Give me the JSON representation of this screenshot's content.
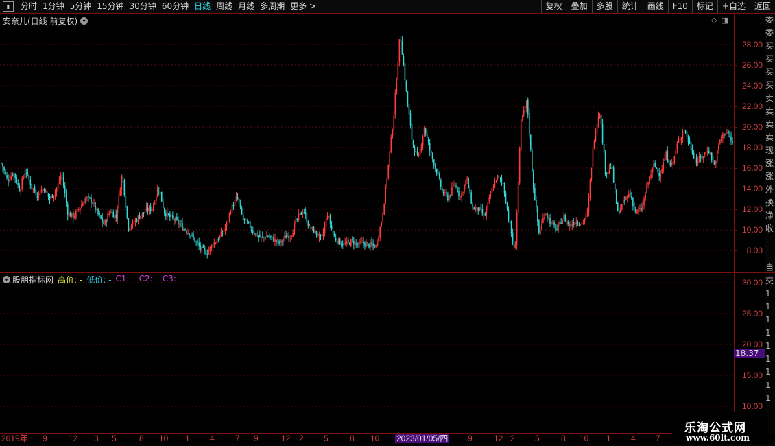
{
  "toolbar": {
    "periods": [
      {
        "label": "分时",
        "active": false
      },
      {
        "label": "1分钟",
        "active": false
      },
      {
        "label": "5分钟",
        "active": false
      },
      {
        "label": "15分钟",
        "active": false
      },
      {
        "label": "30分钟",
        "active": false
      },
      {
        "label": "60分钟",
        "active": false
      },
      {
        "label": "日线",
        "active": true
      },
      {
        "label": "周线",
        "active": false
      },
      {
        "label": "月线",
        "active": false
      },
      {
        "label": "多周期",
        "active": false
      },
      {
        "label": "更多 >",
        "active": false
      }
    ],
    "actions": [
      "复权",
      "叠加",
      "多股",
      "统计",
      "画线",
      "F10",
      "标记",
      "+自选",
      "返回"
    ]
  },
  "main_chart": {
    "title": "安奈儿(日线 前复权)",
    "price_axis": [
      "28.00",
      "26.00",
      "24.00",
      "22.00",
      "20.00",
      "18.00",
      "16.00",
      "14.00",
      "12.00",
      "10.00",
      "8.00"
    ]
  },
  "indicator": {
    "name": "股朋指标网",
    "legend": [
      {
        "label": "高价: -",
        "color": "#e6e64a"
      },
      {
        "label": "低价: -",
        "color": "#2fd5e6"
      },
      {
        "label": "C1: -",
        "color": "#d040d0"
      },
      {
        "label": "C2: -",
        "color": "#d040d0"
      },
      {
        "label": "C3: -",
        "color": "#d040d0"
      }
    ],
    "axis": [
      "30.00",
      "25.00",
      "20.00",
      "15.00",
      "10.00"
    ],
    "current_value": "18.37"
  },
  "date_axis": {
    "labels": [
      "2019年",
      "9",
      "12",
      "3",
      "5",
      "8",
      "10",
      "1",
      "4",
      "7",
      "9",
      "12",
      "2",
      "5",
      "8",
      "10",
      "9",
      "12",
      "2",
      "5",
      "8",
      "10",
      "1",
      "4",
      "7"
    ],
    "highlight": "2023/01/05/四"
  },
  "right_strip": {
    "chars": [
      "委",
      "委",
      "买",
      "买",
      "买",
      "买",
      "卖",
      "卖",
      "卖",
      "卖",
      "现",
      "涨",
      "涨",
      "外",
      "换",
      "净",
      "收"
    ],
    "lower_chars": [
      "自",
      "交",
      "1",
      "1",
      "1",
      "1",
      "1",
      "1",
      "1",
      "1",
      "1"
    ]
  },
  "watermark": {
    "title": "乐淘公式网",
    "url": "www.60lt.com"
  },
  "chart_data": {
    "type": "candlestick",
    "title": "安奈儿(日线 前复权)",
    "ylim": [
      7,
      29.5
    ],
    "period_start": "2019年",
    "highlight_date": "2023/01/05/四",
    "close_path": [
      16.5,
      14.8,
      15.6,
      13.9,
      15.8,
      14.2,
      13.4,
      14.1,
      13.0,
      13.8,
      15.5,
      11.6,
      11.3,
      12.2,
      13.1,
      12.8,
      11.5,
      10.5,
      11.9,
      11.2,
      15.6,
      10.2,
      10.8,
      11.4,
      11.9,
      12.1,
      14.2,
      11.7,
      11.2,
      10.8,
      10.2,
      9.8,
      9.0,
      8.1,
      7.8,
      8.6,
      9.2,
      10.1,
      12.0,
      13.2,
      11.0,
      10.4,
      9.6,
      9.2,
      9.4,
      9.1,
      8.7,
      9.3,
      9.6,
      11.1,
      11.9,
      10.2,
      9.8,
      9.0,
      11.6,
      9.3,
      8.8,
      8.6,
      8.9,
      8.6,
      8.7,
      8.5,
      8.4,
      11.1,
      16.0,
      21.5,
      29.2,
      23.5,
      18.5,
      16.8,
      20.0,
      17.5,
      15.8,
      13.6,
      13.1,
      14.5,
      13.2,
      15.0,
      12.1,
      12.0,
      11.3,
      13.5,
      15.2,
      14.6,
      11.0,
      7.6,
      20.5,
      22.5,
      14.5,
      9.6,
      11.8,
      10.6,
      10.0,
      11.3,
      10.4,
      10.9,
      10.6,
      11.6,
      18.5,
      21.8,
      15.5,
      16.2,
      11.6,
      12.7,
      13.6,
      11.7,
      12.0,
      14.6,
      16.3,
      15.4,
      17.3,
      16.2,
      18.6,
      19.7,
      18.2,
      16.6,
      17.1,
      17.9,
      16.2,
      18.9,
      19.6,
      18.4
    ],
    "xlabels": [
      "2019年",
      "9",
      "12",
      "3",
      "5",
      "8",
      "10",
      "1",
      "4",
      "7",
      "9",
      "12",
      "2",
      "5",
      "8",
      "10",
      "9",
      "12",
      "2",
      "5",
      "8",
      "10",
      "1",
      "4",
      "7"
    ]
  }
}
